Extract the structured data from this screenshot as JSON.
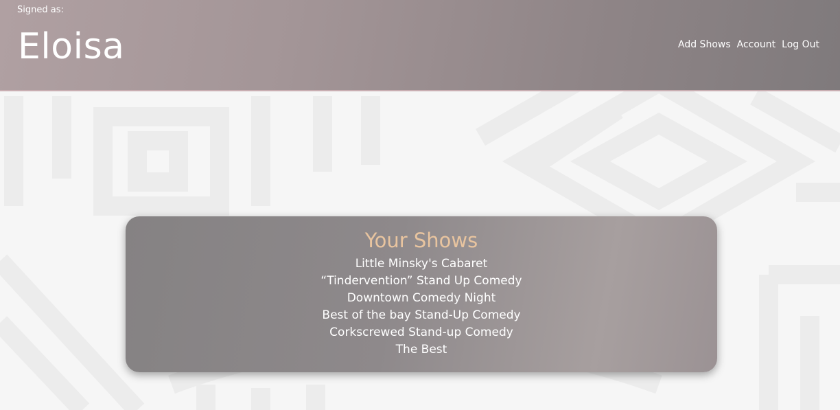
{
  "header": {
    "signed_as_label": "Signed as:",
    "username": "Eloisa",
    "nav": [
      "Add Shows",
      "Account",
      "Log Out"
    ]
  },
  "shows": {
    "title": "Your Shows",
    "items": [
      "Little Minsky's Cabaret",
      "“Tindervention” Stand Up Comedy",
      "Downtown Comedy Night",
      "Best of the bay Stand-Up Comedy",
      "Corkscrewed Stand-up Comedy",
      "The Best"
    ]
  },
  "colors": {
    "title_accent": "#e8c49f",
    "header_start": "#b0a0a2",
    "header_end": "#7f7a7c",
    "page_background": "#f6f6f6"
  }
}
